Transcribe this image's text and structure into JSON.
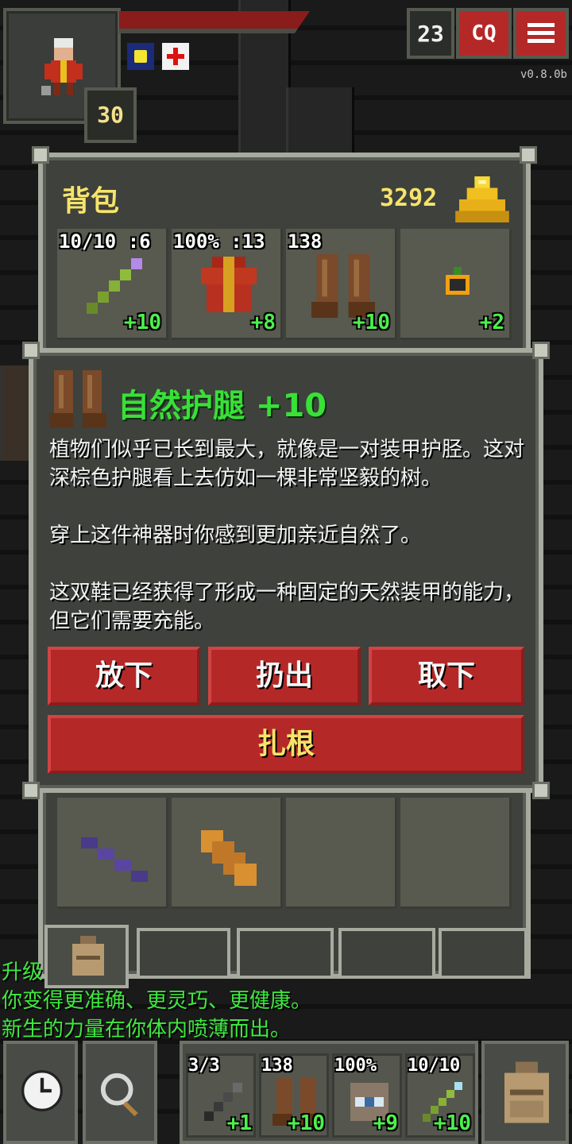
{
  "hud": {
    "level": "30",
    "depth": "23",
    "journal_label": "CQ",
    "version": "v0.8.0b",
    "buff_icons": [
      "light-buff-icon",
      "healing-buff-icon"
    ]
  },
  "backpack": {
    "title": "背包",
    "gold": "3292",
    "equipped": [
      {
        "top": "10/10 :6",
        "bonus": "+10",
        "icon": "wand-icon"
      },
      {
        "top": "100% :13",
        "bonus": "+8",
        "icon": "robe-armor-icon"
      },
      {
        "top": "138",
        "bonus": "+10",
        "icon": "greaves-icon"
      },
      {
        "top": "",
        "bonus": "+2",
        "icon": "ring-icon"
      }
    ],
    "items": [
      {
        "icon": "purple-wand-icon"
      },
      {
        "icon": "scroll-icon"
      }
    ]
  },
  "item_info": {
    "title": "自然护腿 +10",
    "icon": "greaves-icon",
    "desc1": "植物们似乎已长到最大，就像是一对装甲护胫。这对深棕色护腿看上去仿如一棵非常坚毅的树。",
    "desc2": "穿上这件神器时你感到更加亲近自然了。",
    "desc3": "这双鞋已经获得了形成一种固定的天然装甲的能力，但它们需要充能。",
    "buttons": {
      "drop": "放下",
      "throw": "扔出",
      "unequip": "取下",
      "root": "扎根"
    }
  },
  "log": {
    "line1": "升级",
    "line2": "你变得更准确、更灵巧、更健康。",
    "line3": "新生的力量在你体内喷薄而出。"
  },
  "toolbar": {
    "wait_icon": "clock-icon",
    "search_icon": "magnifier-icon",
    "backpack_icon": "backpack-icon",
    "quickslots": [
      {
        "top": "3/3",
        "bonus": "+1",
        "icon": "dagger-icon"
      },
      {
        "top": "138",
        "bonus": "+10",
        "icon": "greaves-icon"
      },
      {
        "top": "100%",
        "bonus": "+9",
        "icon": "eye-tome-icon"
      },
      {
        "top": "10/10",
        "bonus": "+10",
        "icon": "wand-icon"
      }
    ]
  },
  "colors": {
    "button_red": "#b52828",
    "title_green": "#38e038",
    "gold_yellow": "#f6e36a",
    "log_green": "#3fe83f"
  }
}
